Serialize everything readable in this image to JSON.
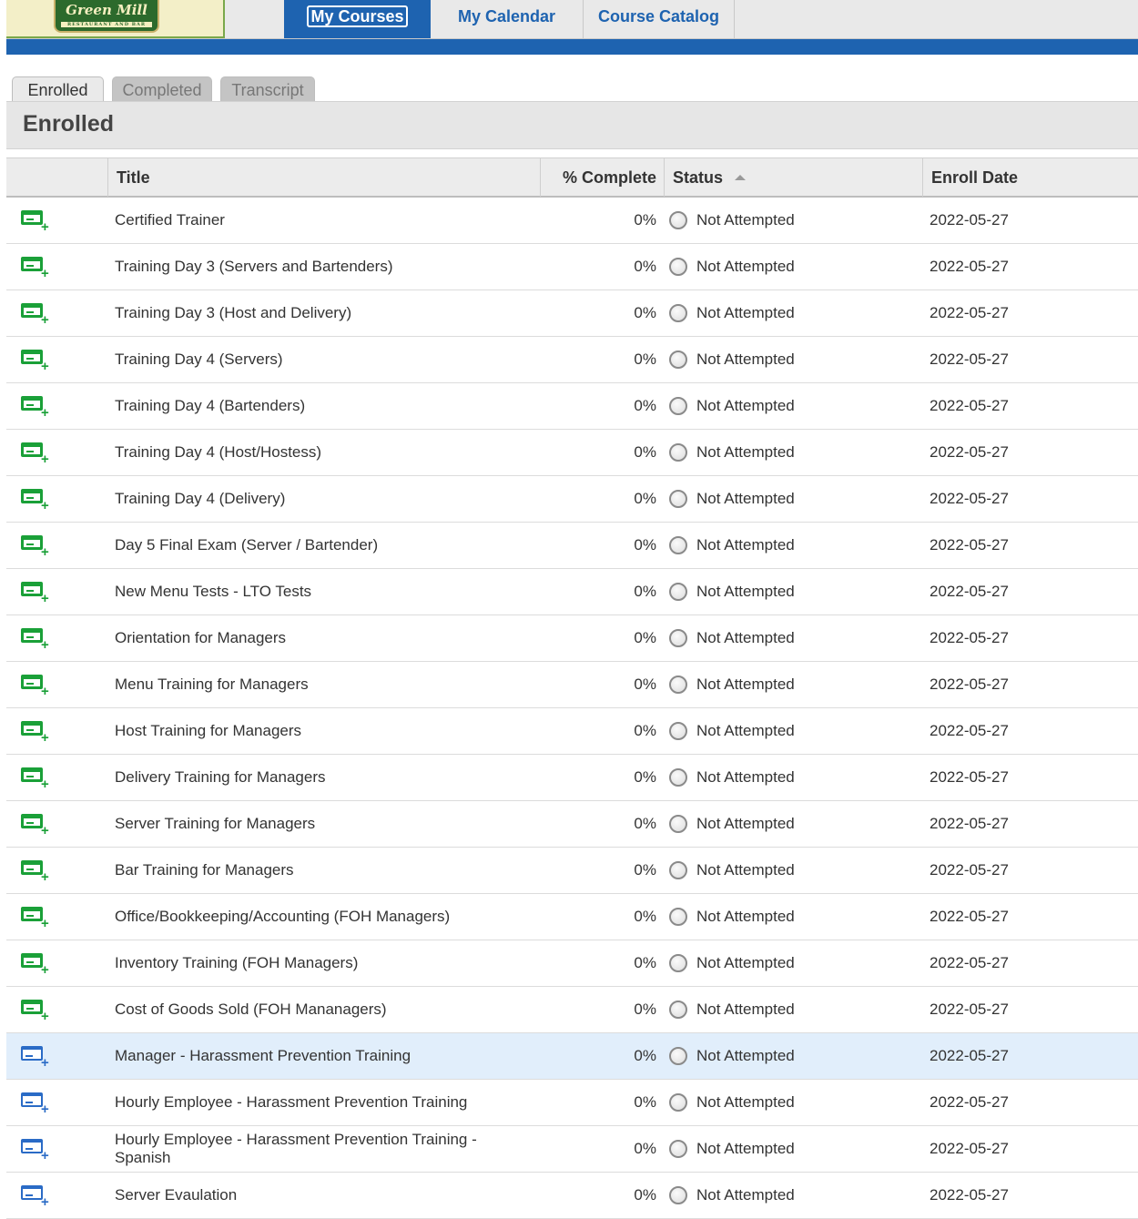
{
  "nav": {
    "logo_text": "Green Mill",
    "logo_sub": "RESTAURANT AND BAR",
    "tabs": [
      {
        "label": "My Courses",
        "active": true
      },
      {
        "label": "My Calendar",
        "active": false
      },
      {
        "label": "Course Catalog",
        "active": false
      }
    ]
  },
  "subtabs": [
    {
      "label": "Enrolled",
      "active": true
    },
    {
      "label": "Completed",
      "active": false
    },
    {
      "label": "Transcript",
      "active": false
    }
  ],
  "section_title": "Enrolled",
  "table": {
    "columns": [
      "Title",
      "% Complete",
      "Status",
      "Enroll Date"
    ],
    "sorted_column": "Status",
    "sort_direction": "ascending",
    "rows": [
      {
        "title": "Certified Trainer",
        "pct": "0%",
        "status": "Not Attempted",
        "date": "2022-05-27",
        "icon": "course-green-icon"
      },
      {
        "title": "Training Day 3 (Servers and Bartenders)",
        "pct": "0%",
        "status": "Not Attempted",
        "date": "2022-05-27",
        "icon": "course-green-icon"
      },
      {
        "title": "Training Day 3 (Host and Delivery)",
        "pct": "0%",
        "status": "Not Attempted",
        "date": "2022-05-27",
        "icon": "course-green-icon"
      },
      {
        "title": "Training Day 4 (Servers)",
        "pct": "0%",
        "status": "Not Attempted",
        "date": "2022-05-27",
        "icon": "course-green-icon"
      },
      {
        "title": "Training Day 4 (Bartenders)",
        "pct": "0%",
        "status": "Not Attempted",
        "date": "2022-05-27",
        "icon": "course-green-icon"
      },
      {
        "title": "Training Day 4 (Host/Hostess)",
        "pct": "0%",
        "status": "Not Attempted",
        "date": "2022-05-27",
        "icon": "course-green-icon"
      },
      {
        "title": "Training Day 4 (Delivery)",
        "pct": "0%",
        "status": "Not Attempted",
        "date": "2022-05-27",
        "icon": "course-green-icon"
      },
      {
        "title": "Day 5 Final Exam (Server / Bartender)",
        "pct": "0%",
        "status": "Not Attempted",
        "date": "2022-05-27",
        "icon": "course-green-icon"
      },
      {
        "title": "New Menu Tests - LTO Tests",
        "pct": "0%",
        "status": "Not Attempted",
        "date": "2022-05-27",
        "icon": "course-green-icon"
      },
      {
        "title": "Orientation for Managers",
        "pct": "0%",
        "status": "Not Attempted",
        "date": "2022-05-27",
        "icon": "course-green-icon"
      },
      {
        "title": "Menu Training for Managers",
        "pct": "0%",
        "status": "Not Attempted",
        "date": "2022-05-27",
        "icon": "course-green-icon"
      },
      {
        "title": "Host Training for Managers",
        "pct": "0%",
        "status": "Not Attempted",
        "date": "2022-05-27",
        "icon": "course-green-icon"
      },
      {
        "title": "Delivery Training for Managers",
        "pct": "0%",
        "status": "Not Attempted",
        "date": "2022-05-27",
        "icon": "course-green-icon"
      },
      {
        "title": "Server Training for Managers",
        "pct": "0%",
        "status": "Not Attempted",
        "date": "2022-05-27",
        "icon": "course-green-icon"
      },
      {
        "title": "Bar Training for Managers",
        "pct": "0%",
        "status": "Not Attempted",
        "date": "2022-05-27",
        "icon": "course-green-icon"
      },
      {
        "title": "Office/Bookkeeping/Accounting (FOH Managers)",
        "pct": "0%",
        "status": "Not Attempted",
        "date": "2022-05-27",
        "icon": "course-green-icon"
      },
      {
        "title": "Inventory Training (FOH Managers)",
        "pct": "0%",
        "status": "Not Attempted",
        "date": "2022-05-27",
        "icon": "course-green-icon"
      },
      {
        "title": "Cost of Goods Sold (FOH Mananagers)",
        "pct": "0%",
        "status": "Not Attempted",
        "date": "2022-05-27",
        "icon": "course-green-icon"
      },
      {
        "title": "Manager - Harassment Prevention Training",
        "pct": "0%",
        "status": "Not Attempted",
        "date": "2022-05-27",
        "icon": "course-blue-icon",
        "highlighted": true
      },
      {
        "title": "Hourly Employee - Harassment Prevention Training",
        "pct": "0%",
        "status": "Not Attempted",
        "date": "2022-05-27",
        "icon": "course-blue-icon"
      },
      {
        "title": "Hourly Employee - Harassment Prevention Training - Spanish",
        "pct": "0%",
        "status": "Not Attempted",
        "date": "2022-05-27",
        "icon": "course-blue-icon"
      },
      {
        "title": "Server Evaulation",
        "pct": "0%",
        "status": "Not Attempted",
        "date": "2022-05-27",
        "icon": "course-blue-icon"
      }
    ]
  },
  "colors": {
    "nav_blue": "#1e63b0",
    "icon_green": "#1aa038",
    "icon_blue": "#2a6bc6",
    "highlight_row": "#e1eefb"
  }
}
